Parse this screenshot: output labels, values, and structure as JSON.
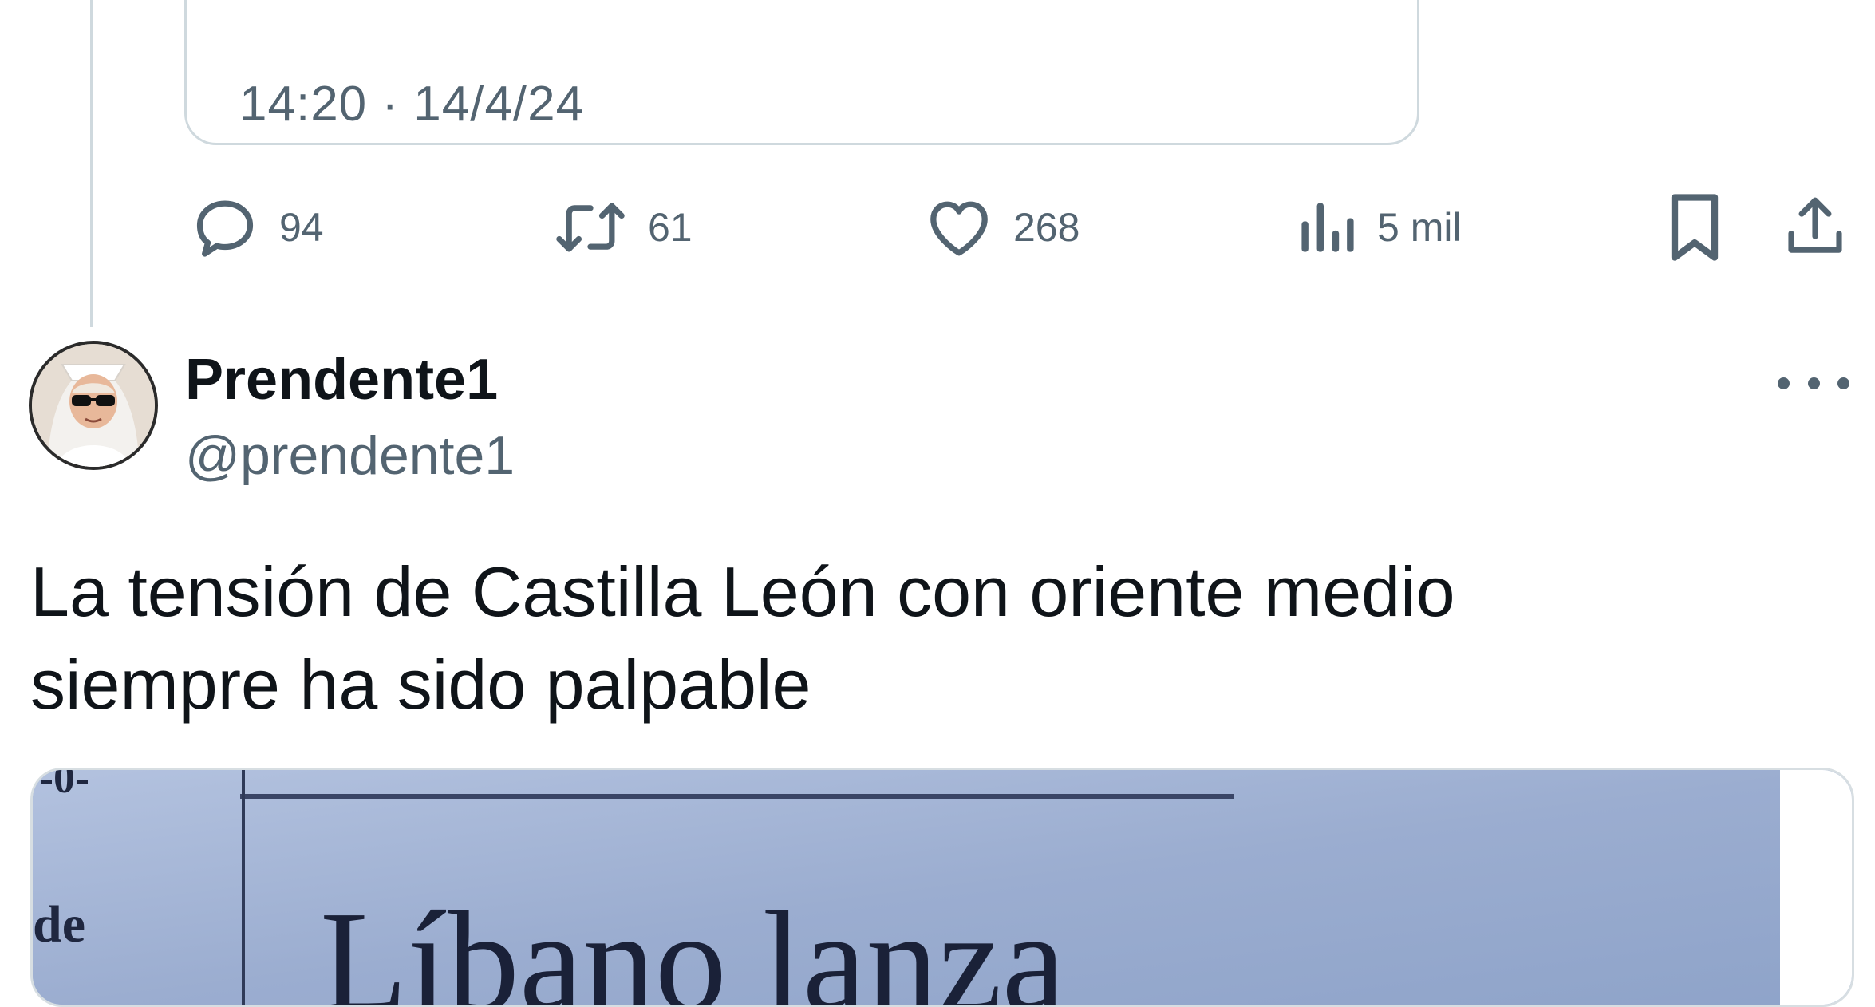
{
  "quoted_tweet": {
    "timestamp": "14:20 · 14/4/24"
  },
  "action_bar": {
    "reply_count": "94",
    "retweet_count": "61",
    "like_count": "268",
    "views_count": "5 mil",
    "icons": [
      "reply-icon",
      "retweet-icon",
      "like-icon",
      "views-icon",
      "bookmark-icon",
      "share-icon"
    ]
  },
  "tweet": {
    "display_name": "Prendente1",
    "handle": "@prendente1",
    "text_line1": "La tensión de Castilla León con oriente medio",
    "text_line2": "siempre ha sido palpable",
    "media": {
      "fragment_top": "-0-",
      "fragment_side": "de",
      "headline": "Líbano lanza"
    }
  },
  "colors": {
    "text_primary": "#0f1419",
    "text_secondary": "#536471",
    "border": "#cfd9de",
    "newspaper_bg": "#9fb2d3"
  }
}
